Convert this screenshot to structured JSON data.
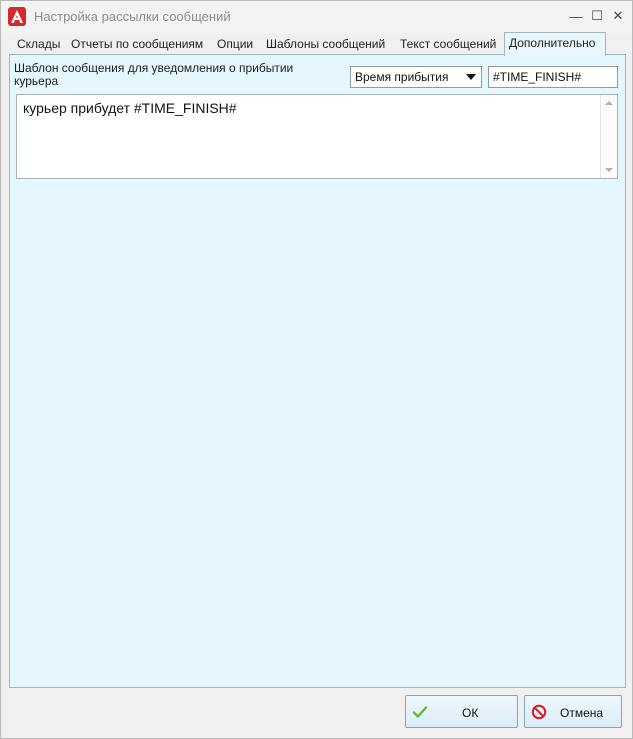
{
  "window": {
    "title": "Настройка рассылки сообщений",
    "app_icon": "app-logo-a",
    "minimize_glyph": "—",
    "maximize_glyph": "☐",
    "close_glyph": "✕"
  },
  "tabs": [
    {
      "label": "Склады",
      "active": false
    },
    {
      "label": "Отчеты по сообщениям",
      "active": false
    },
    {
      "label": "Опции",
      "active": false
    },
    {
      "label": "Шаблоны сообщений",
      "active": false
    },
    {
      "label": "Текст сообщений",
      "active": false
    },
    {
      "label": "Дополнительно",
      "active": true
    }
  ],
  "template_section": {
    "label": "Шаблон сообщения для уведомления о прибытии курьера",
    "variable_select": {
      "selected": "Время прибытия"
    },
    "token_value": "#TIME_FINISH#",
    "text": "курьер прибудет #TIME_FINISH#"
  },
  "footer": {
    "ok_label": "ОК",
    "ok_icon": "checkmark-icon",
    "cancel_label": "Отмена",
    "cancel_icon": "no-entry-icon"
  },
  "colors": {
    "panel_bg": "#e6f6fd",
    "title_text": "#8d8d8d",
    "brand_red": "#d9272e"
  }
}
